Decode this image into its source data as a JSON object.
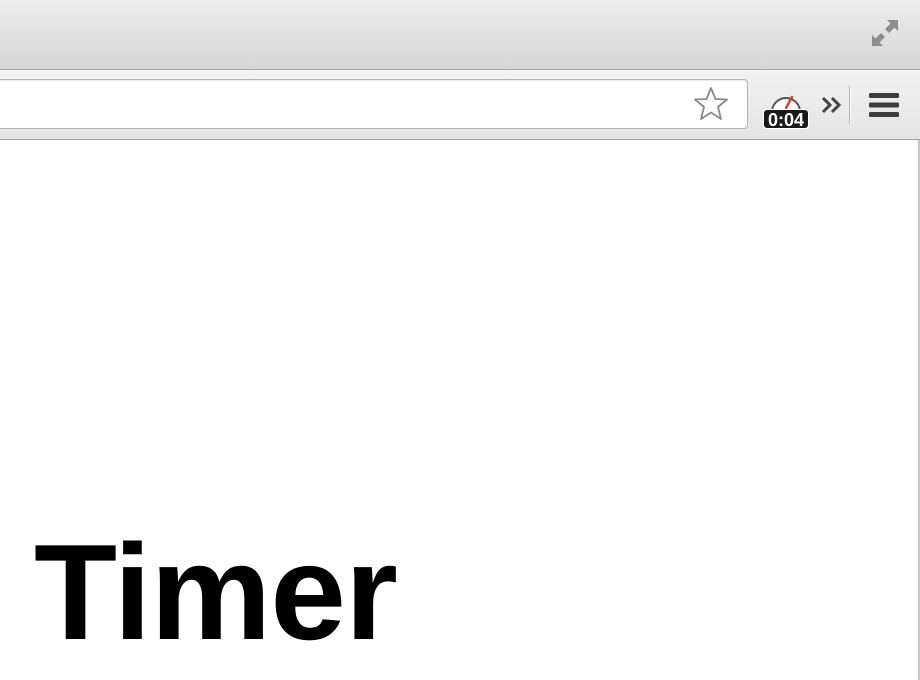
{
  "toolbar": {
    "omnibox": {
      "value": "",
      "placeholder": ""
    },
    "bookmark_icon": "star-outline-icon",
    "timer_extension": {
      "badge_text": "0:04",
      "icon": "stopwatch-gauge-icon",
      "needle_color": "#e03a2f"
    },
    "overflow_icon": "double-chevron-right-icon",
    "menu_icon": "hamburger-menu-icon"
  },
  "titlebar": {
    "fullscreen_icon": "fullscreen-expand-icon"
  },
  "page": {
    "heading": "Timer"
  }
}
